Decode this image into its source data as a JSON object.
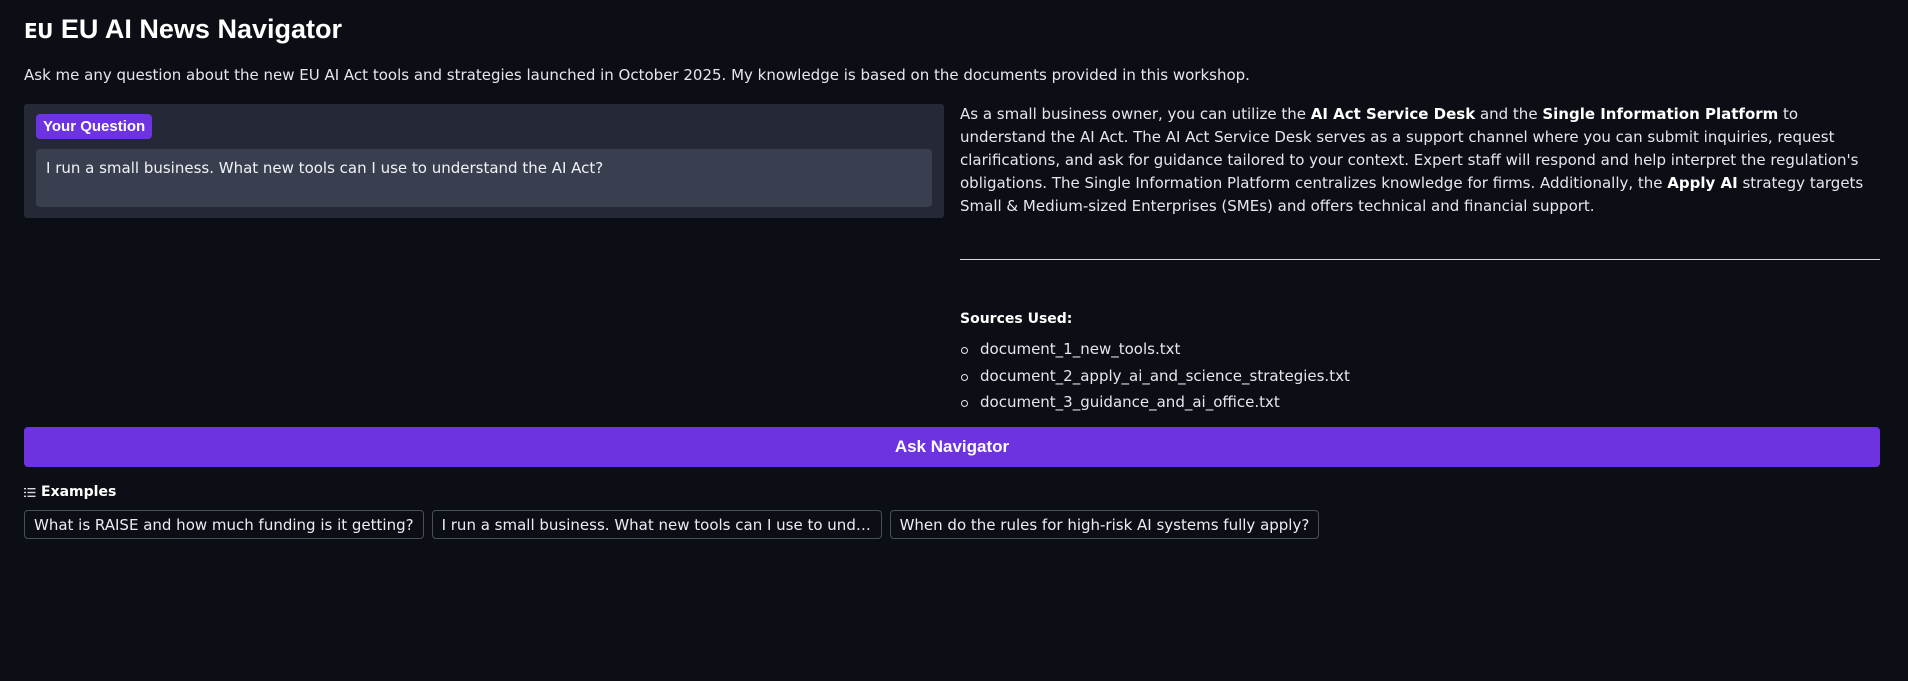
{
  "header": {
    "flag": "EU",
    "title": "EU AI News Navigator"
  },
  "subtitle": "Ask me any question about the new EU AI Act tools and strategies launched in October 2025. My knowledge is based on the documents provided in this workshop.",
  "question": {
    "label": "Your Question",
    "value": "I run a small business. What new tools can I use to understand the AI Act?"
  },
  "answer": {
    "p1": "As a small business owner, you can utilize the ",
    "b1": "AI Act Service Desk",
    "p2": " and the ",
    "b2": "Single Information Platform",
    "p3": " to understand the AI Act. The AI Act Service Desk serves as a support channel where you can submit inquiries, request clarifications, and ask for guidance tailored to your context. Expert staff will respond and help interpret the regulation's obligations. The Single Information Platform centralizes knowledge for firms. Additionally, the ",
    "b3": "Apply AI",
    "p4": " strategy targets Small & Medium-sized Enterprises (SMEs) and offers technical and financial support."
  },
  "sources": {
    "heading": "Sources Used:",
    "items": [
      "document_1_new_tools.txt",
      "document_2_apply_ai_and_science_strategies.txt",
      "document_3_guidance_and_ai_office.txt"
    ]
  },
  "ask_button": "Ask Navigator",
  "examples": {
    "heading": "Examples",
    "items": [
      "What is RAISE and how much funding is it getting?",
      "I run a small business. What new tools can I use to understand the AI Act?",
      "When do the rules for high-risk AI systems fully apply?"
    ]
  },
  "colors": {
    "background": "#0c0e16",
    "accent": "#6d33e0",
    "panel": "#252937",
    "input": "#3a3f50"
  }
}
